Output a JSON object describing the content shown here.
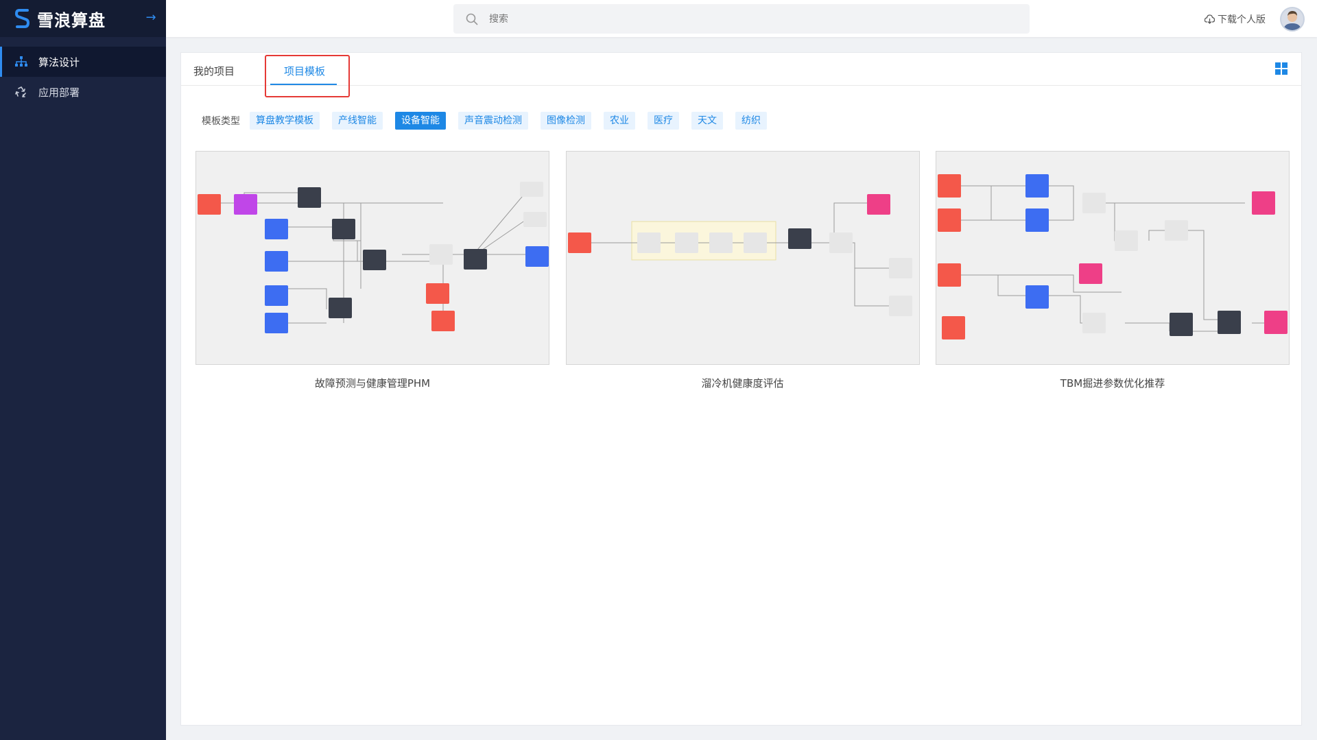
{
  "app": {
    "name": "雪浪算盘"
  },
  "sidebar": {
    "items": [
      {
        "label": "算法设计",
        "icon": "sitemap-icon",
        "active": true
      },
      {
        "label": "应用部署",
        "icon": "recycle-icon",
        "active": false
      }
    ]
  },
  "header": {
    "search": {
      "placeholder": "搜索"
    },
    "download_label": "下载个人版"
  },
  "tabs": [
    {
      "label": "我的项目",
      "active": false
    },
    {
      "label": "项目模板",
      "active": true
    }
  ],
  "filters": {
    "label": "模板类型",
    "chips": [
      {
        "label": "算盘教学模板",
        "active": false
      },
      {
        "label": "产线智能",
        "active": false
      },
      {
        "label": "设备智能",
        "active": true
      },
      {
        "label": "声音震动检测",
        "active": false
      },
      {
        "label": "图像检测",
        "active": false
      },
      {
        "label": "农业",
        "active": false
      },
      {
        "label": "医疗",
        "active": false
      },
      {
        "label": "天文",
        "active": false
      },
      {
        "label": "纺织",
        "active": false
      }
    ]
  },
  "templates": [
    {
      "title": "故障预测与健康管理PHM"
    },
    {
      "title": "溜冷机健康度评估"
    },
    {
      "title": "TBM掘进参数优化推荐"
    }
  ],
  "colors": {
    "accent": "#1e88e5",
    "sidebar_bg": "#1b2440",
    "highlight_border": "#e53935",
    "node_red": "#f4584a",
    "node_purple": "#c046e8",
    "node_blue": "#3d6df2",
    "node_dark": "#3a3f4b",
    "node_pink": "#ee3f87"
  }
}
